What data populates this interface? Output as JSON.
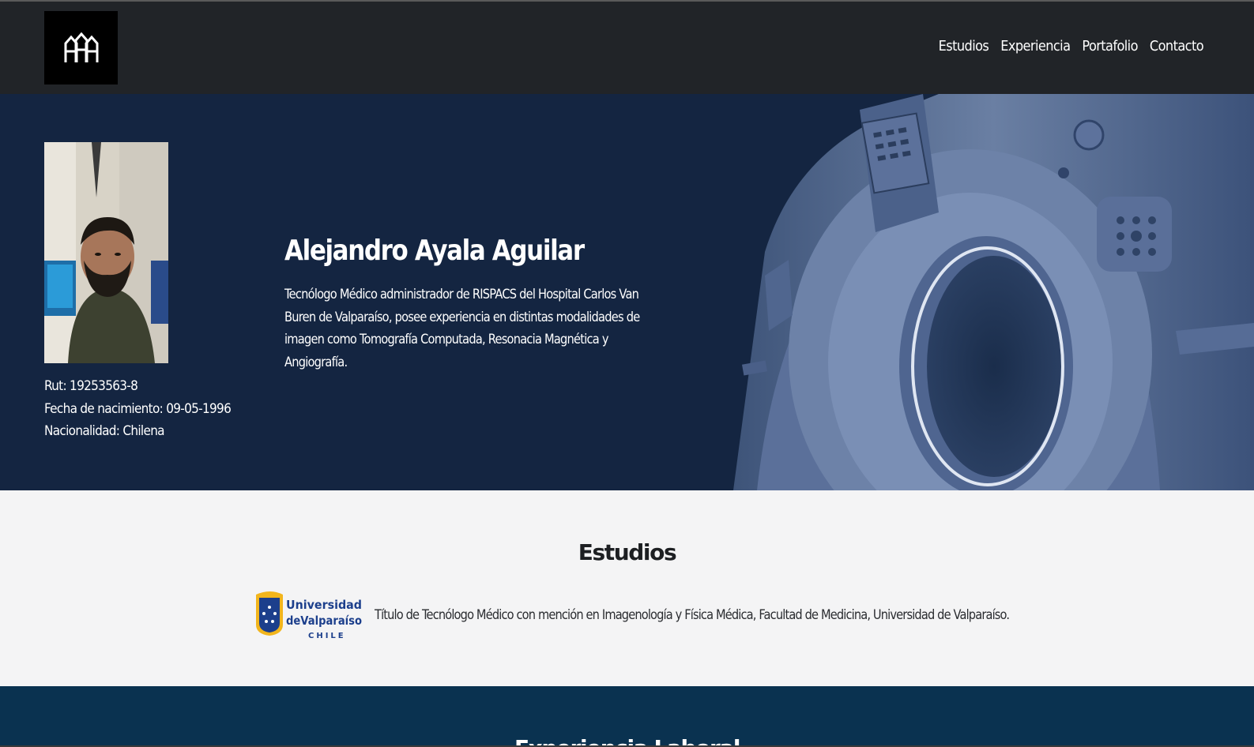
{
  "nav": {
    "logo_text": "AAA",
    "links": [
      {
        "label": "Estudios"
      },
      {
        "label": "Experiencia"
      },
      {
        "label": "Portafolio"
      },
      {
        "label": "Contacto"
      }
    ]
  },
  "hero": {
    "name": "Alejandro Ayala Aguilar",
    "description": "Tecnólogo Médico administrador de RISPACS del Hospital Carlos Van Buren de Valparaíso, posee experiencia en distintas modalidades de imagen como Tomografía Computada, Resonacia Magnética y Angiografía.",
    "rut": "Rut: 19253563-8",
    "birth": "Fecha de nacimiento: 09-05-1996",
    "nationality": "Nacionalidad: Chilena"
  },
  "estudios": {
    "title": "Estudios",
    "university_logo": {
      "line1": "Universidad",
      "line2": "deValparaíso",
      "line3": "CHILE"
    },
    "item": "Título de Tecnólogo Médico con mención en Imagenología y Física Médica, Facultad de Medicina, Universidad de Valparaíso."
  },
  "experiencia": {
    "title": "Experiencia Laboral"
  },
  "colors": {
    "navbar": "#212428",
    "hero_bg": "#142541",
    "estudios_bg": "#f4f4f5",
    "experiencia_bg": "#0a3250"
  }
}
